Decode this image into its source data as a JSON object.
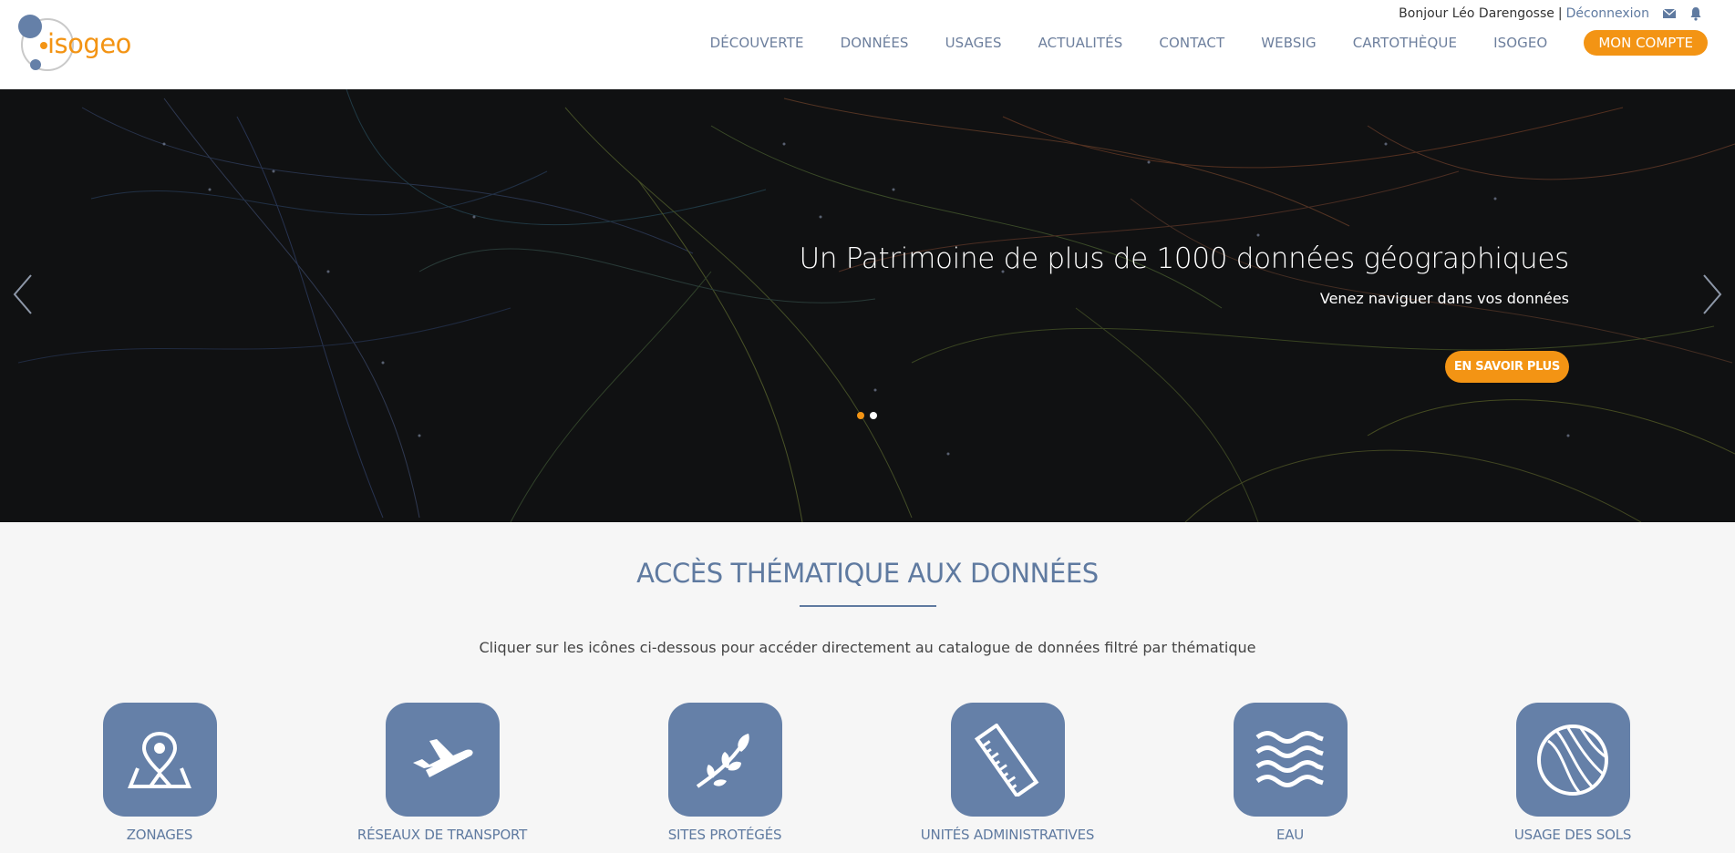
{
  "header": {
    "logo_text": "isogeo",
    "user": {
      "greeting": "Bonjour Léo Darengosse",
      "separator": "|",
      "logout": "Déconnexion",
      "mail_icon": "mail-icon",
      "bell_icon": "bell-icon"
    },
    "nav": [
      {
        "label": "DÉCOUVERTE"
      },
      {
        "label": "DONNÉES"
      },
      {
        "label": "USAGES"
      },
      {
        "label": "ACTUALITÉS"
      },
      {
        "label": "CONTACT"
      },
      {
        "label": "WEBSIG"
      },
      {
        "label": "CARTOTHÈQUE"
      },
      {
        "label": "ISOGEO"
      }
    ],
    "account_button": "MON COMPTE"
  },
  "hero": {
    "title": "Un Patrimoine de plus de 1000 données géographiques",
    "subtitle": "Venez naviguer dans vos données",
    "button": "EN SAVOIR PLUS",
    "prev_icon": "chevron-left-icon",
    "next_icon": "chevron-right-icon",
    "slides_total": 2,
    "active_slide": 1
  },
  "thematic": {
    "title": "ACCÈS THÉMATIQUE AUX DONNÉES",
    "description": "Cliquer sur les icônes ci-dessous pour accéder directement au catalogue de données filtré par thématique",
    "items": [
      {
        "label": "ZONAGES",
        "icon": "map-pin-icon"
      },
      {
        "label": "RÉSEAUX DE TRANSPORT",
        "icon": "airplane-icon"
      },
      {
        "label": "SITES PROTÉGÉS",
        "icon": "leaf-branch-icon"
      },
      {
        "label": "UNITÉS ADMINISTRATIVES",
        "icon": "ruler-icon"
      },
      {
        "label": "EAU",
        "icon": "waves-icon"
      },
      {
        "label": "USAGE DES SOLS",
        "icon": "land-use-icon"
      }
    ]
  },
  "colors": {
    "accent": "#f39414",
    "primary": "#5f7aa0",
    "icon_tile": "#6580a8",
    "hero_bg": "#101112"
  }
}
